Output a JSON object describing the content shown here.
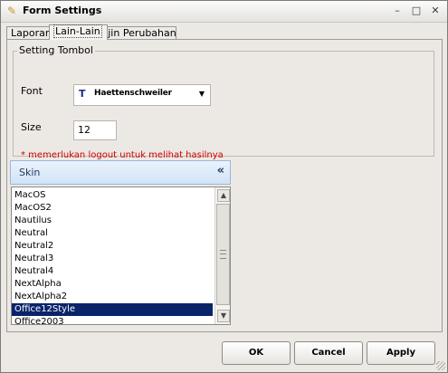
{
  "window": {
    "title": "Form Settings",
    "icon": "app-key-icon",
    "controls": {
      "minimize": "–",
      "maximize": "□",
      "close": "✕"
    }
  },
  "tabs": [
    "Laporan",
    "Lain-Lain",
    "Ijin Perubahan"
  ],
  "active_tab": "Lain-Lain",
  "setting_tombol": {
    "group_title": "Setting Tombol",
    "font_label": "Font",
    "font_value": "Haettenschweiler",
    "size_label": "Size",
    "size_value": "12",
    "note": "* memerlukan logout untuk melihat hasilnya"
  },
  "skin": {
    "title": "Skin",
    "collapse_glyph": "«",
    "items": [
      "MacOS",
      "MacOS2",
      "Nautilus",
      "Neutral",
      "Neutral2",
      "Neutral3",
      "Neutral4",
      "NextAlpha",
      "NextAlpha2",
      "Office12Style",
      "Office2003"
    ],
    "selected": "Office12Style"
  },
  "buttons": {
    "ok": "OK",
    "cancel": "Cancel",
    "apply": "Apply"
  },
  "colors": {
    "selection": "#0A246A",
    "note_red": "#D10000",
    "skin_header_text": "#1E395B"
  }
}
